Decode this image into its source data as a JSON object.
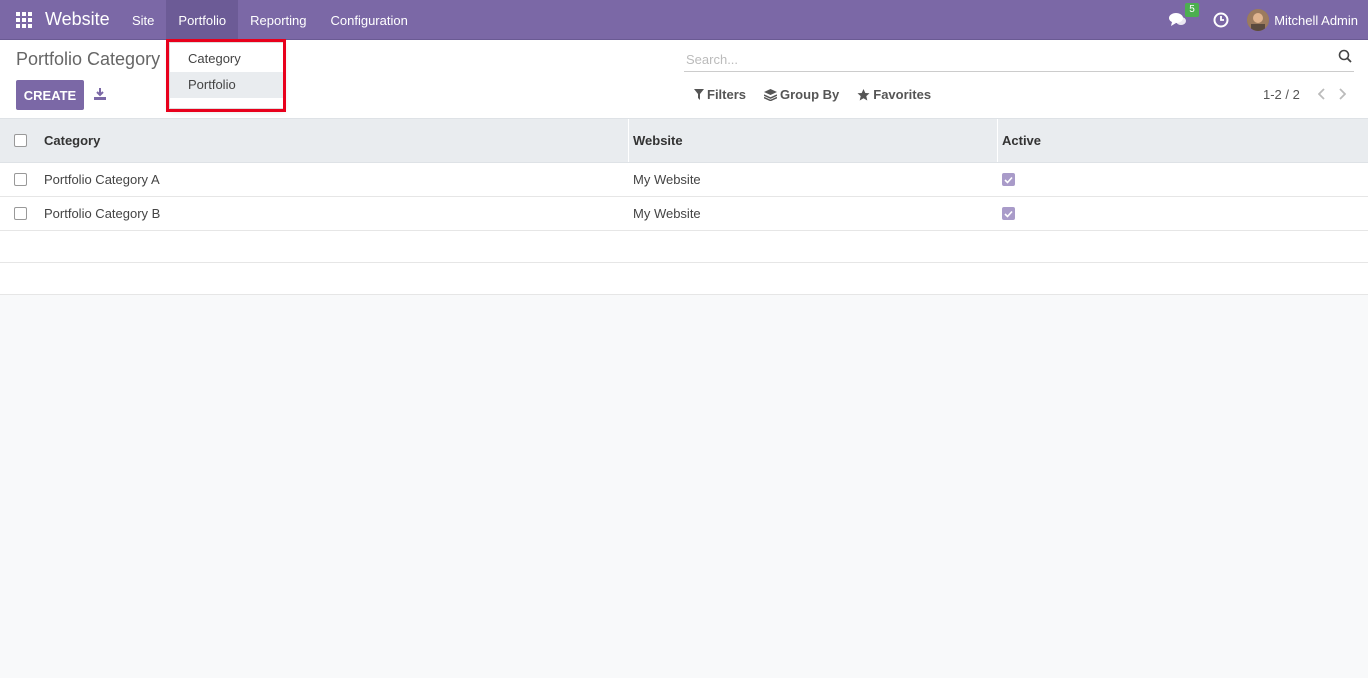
{
  "navbar": {
    "brand": "Website",
    "menu": [
      "Site",
      "Portfolio",
      "Reporting",
      "Configuration"
    ],
    "chat_badge": "5",
    "user_name": "Mitchell Admin"
  },
  "dropdown": {
    "items": [
      "Category",
      "Portfolio"
    ]
  },
  "control_panel": {
    "title": "Portfolio Category",
    "create_label": "CREATE",
    "search_placeholder": "Search...",
    "filters_label": "Filters",
    "group_by_label": "Group By",
    "favorites_label": "Favorites",
    "pager": "1-2 / 2"
  },
  "table": {
    "columns": [
      "Category",
      "Website",
      "Active"
    ],
    "rows": [
      {
        "category": "Portfolio Category A",
        "website": "My Website",
        "active": true
      },
      {
        "category": "Portfolio Category B",
        "website": "My Website",
        "active": true
      }
    ]
  },
  "colors": {
    "navbar": "#7b68a6",
    "highlight": "#e8001c",
    "badge": "#4caf50"
  }
}
